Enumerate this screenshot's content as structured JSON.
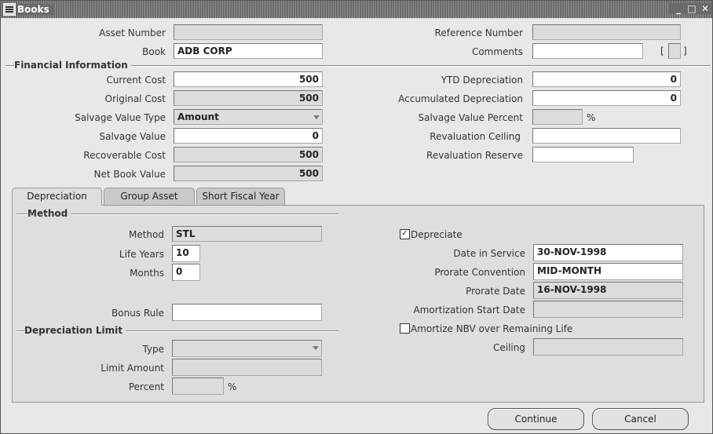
{
  "window": {
    "title": "Books"
  },
  "header": {
    "asset_number_label": "Asset Number",
    "asset_number_value": "",
    "book_label": "Book",
    "book_value": "ADB CORP",
    "reference_number_label": "Reference Number",
    "reference_number_value": "",
    "comments_label": "Comments",
    "comments_value": "",
    "bracket_open": "[",
    "bracket_close": "]"
  },
  "financial": {
    "section_title": "Financial Information",
    "current_cost_label": "Current Cost",
    "current_cost": "500",
    "original_cost_label": "Original Cost",
    "original_cost": "500",
    "salvage_value_type_label": "Salvage Value Type",
    "salvage_value_type": "Amount",
    "salvage_value_label": "Salvage Value",
    "salvage_value": "0",
    "recoverable_cost_label": "Recoverable Cost",
    "recoverable_cost": "500",
    "net_book_value_label": "Net Book Value",
    "net_book_value": "500",
    "ytd_depreciation_label": "YTD Depreciation",
    "ytd_depreciation": "0",
    "accumulated_depreciation_label": "Accumulated Depreciation",
    "accumulated_depreciation": "0",
    "salvage_value_percent_label": "Salvage Value Percent",
    "salvage_value_percent": "",
    "percent_sign": "%",
    "revaluation_ceiling_label": "Revaluation Ceiling",
    "revaluation_ceiling": "",
    "revaluation_reserve_label": "Revaluation Reserve",
    "revaluation_reserve": ""
  },
  "tabs": [
    {
      "label": "Depreciation",
      "active": true
    },
    {
      "label": "Group Asset",
      "active": false
    },
    {
      "label": "Short Fiscal Year",
      "active": false
    }
  ],
  "depreciation": {
    "method_section": "Method",
    "method_label": "Method",
    "method_value": "STL",
    "life_years_label": "Life Years",
    "life_years": "10",
    "months_label": "Months",
    "months": "0",
    "bonus_rule_label": "Bonus Rule",
    "bonus_rule": "",
    "depreciate_label": "Depreciate",
    "depreciate_checked": true,
    "date_in_service_label": "Date in Service",
    "date_in_service": "30-NOV-1998",
    "prorate_convention_label": "Prorate Convention",
    "prorate_convention": "MID-MONTH",
    "prorate_date_label": "Prorate Date",
    "prorate_date": "16-NOV-1998",
    "amortization_start_label": "Amortization Start Date",
    "amortization_start": "",
    "amortize_nbv_label": "Amortize NBV over Remaining Life",
    "amortize_nbv_checked": false,
    "limit_section": "Depreciation Limit",
    "type_label": "Type",
    "type_value": "",
    "limit_amount_label": "Limit Amount",
    "limit_amount": "",
    "percent_label": "Percent",
    "percent_value": "",
    "percent_sign": "%",
    "ceiling_label": "Ceiling",
    "ceiling_value": ""
  },
  "buttons": {
    "continue": "Continue",
    "cancel": "Cancel"
  },
  "colors": {
    "titlebar": "#6a6a6a",
    "panel": "#dedede",
    "readonly_field": "#dcdcdc"
  }
}
